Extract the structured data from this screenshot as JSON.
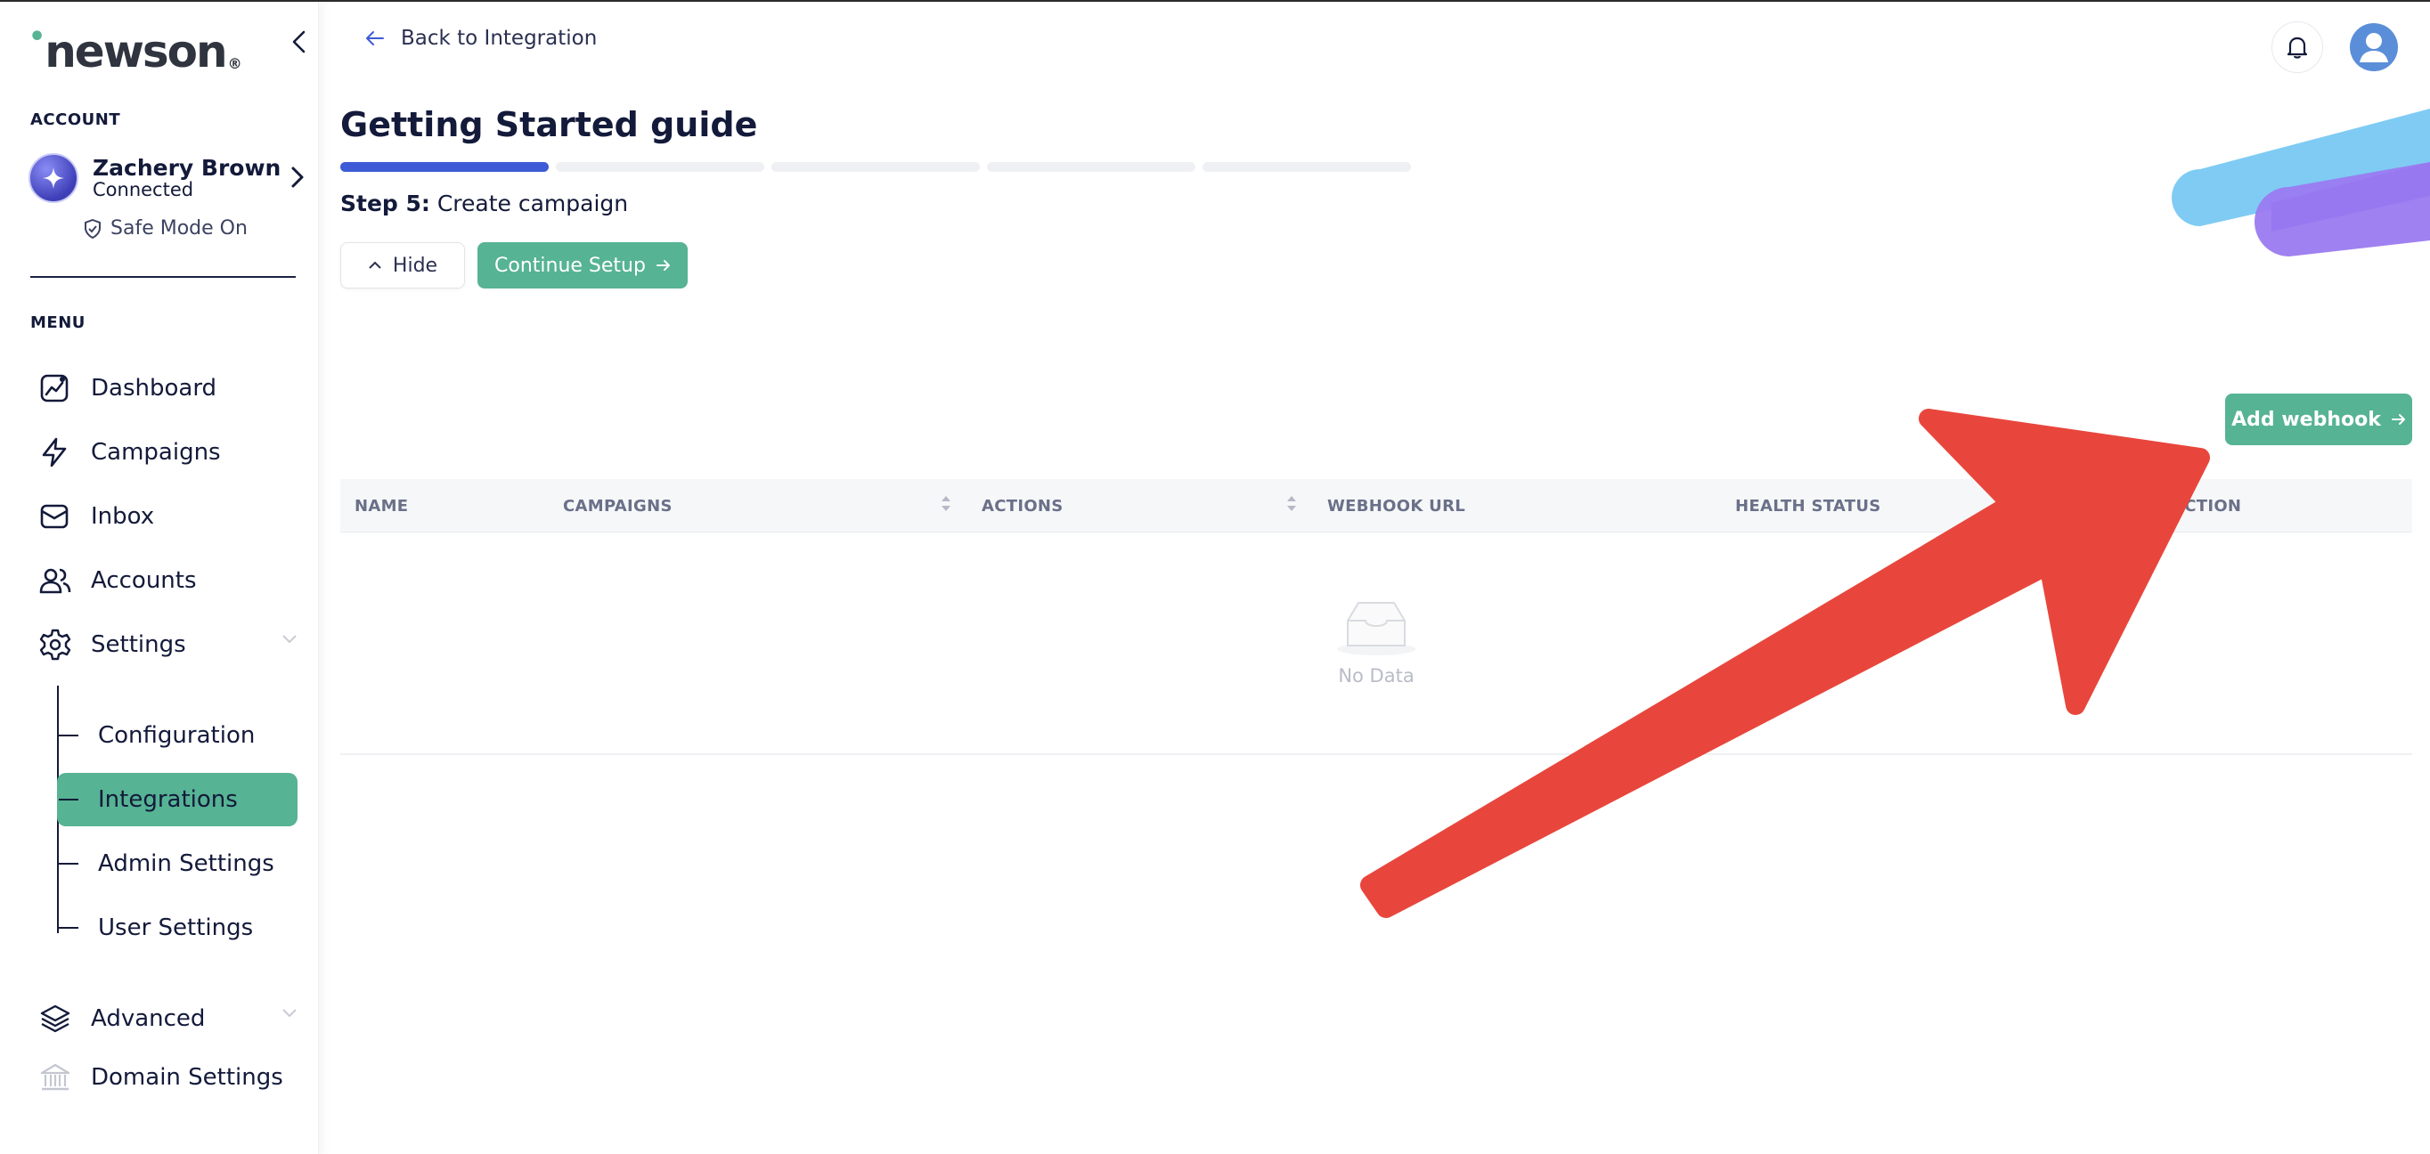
{
  "brand": {
    "name": "newson"
  },
  "sidebar": {
    "account_label": "ACCOUNT",
    "account": {
      "name": "Zachery Brown",
      "status": "Connected"
    },
    "safe_mode": "Safe Mode On",
    "menu_label": "MENU",
    "items": [
      {
        "label": "Dashboard",
        "icon": "dashboard-icon"
      },
      {
        "label": "Campaigns",
        "icon": "lightning-icon"
      },
      {
        "label": "Inbox",
        "icon": "mail-icon"
      },
      {
        "label": "Accounts",
        "icon": "users-icon"
      },
      {
        "label": "Settings",
        "icon": "gear-icon"
      }
    ],
    "settings_children": [
      {
        "label": "Configuration"
      },
      {
        "label": "Integrations",
        "active": true
      },
      {
        "label": "Admin Settings"
      },
      {
        "label": "User Settings"
      }
    ],
    "advanced": {
      "label": "Advanced",
      "icon": "layers-icon"
    },
    "domain": {
      "label": "Domain Settings",
      "icon": "bank-icon"
    }
  },
  "header": {
    "back_label": "Back to Integration"
  },
  "guide": {
    "title": "Getting Started guide",
    "step_prefix": "Step 5:",
    "step_text": " Create campaign",
    "steps_total": 5,
    "steps_done": 1,
    "hide_label": "Hide",
    "continue_label": "Continue Setup"
  },
  "webhooks": {
    "add_label": "Add webhook",
    "columns": [
      "NAME",
      "CAMPAIGNS",
      "ACTIONS",
      "WEBHOOK URL",
      "HEALTH STATUS",
      "ACTION"
    ],
    "empty_text": "No Data"
  },
  "colors": {
    "accent": "#56b394",
    "progress": "#3d5bd6",
    "arrow": "#e8463c",
    "text": "#131a3a"
  }
}
